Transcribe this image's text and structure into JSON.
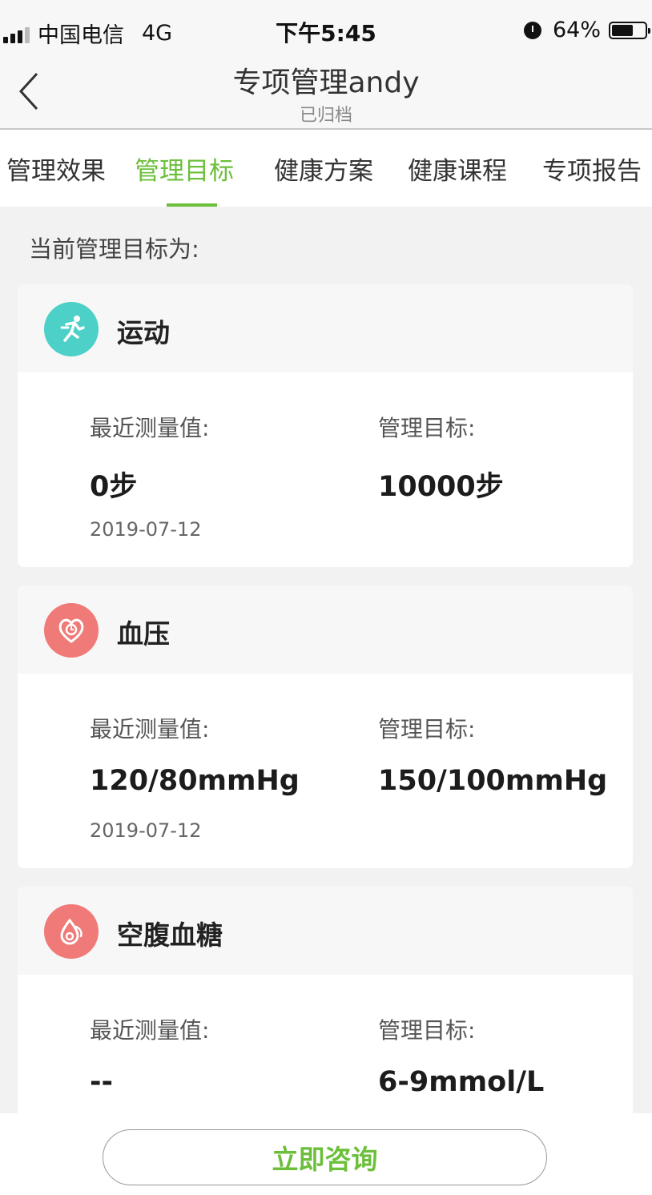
{
  "status_bar": {
    "carrier": "中国电信",
    "network": "4G",
    "time": "下午5:45",
    "battery": "64%",
    "battery_level": 0.64
  },
  "header": {
    "title": "专项管理andy",
    "subtitle": "已归档"
  },
  "tabs": [
    {
      "label": "管理效果"
    },
    {
      "label": "管理目标"
    },
    {
      "label": "健康方案"
    },
    {
      "label": "健康课程"
    },
    {
      "label": "专项报告"
    }
  ],
  "active_tab": "管理目标",
  "section_label": "当前管理目标为:",
  "cards": [
    {
      "title": "运动",
      "icon": "running-icon",
      "icon_color": "#4dd0c8",
      "recent_label": "最近测量值:",
      "recent_value": "0步",
      "recent_date": "2019-07-12",
      "target_label": "管理目标:",
      "target_value": "10000步"
    },
    {
      "title": "血压",
      "icon": "heart-pressure-icon",
      "icon_color": "#f07a78",
      "recent_label": "最近测量值:",
      "recent_value": "120/80mmHg",
      "recent_date": "2019-07-12",
      "target_label": "管理目标:",
      "target_value": "150/100mmHg"
    },
    {
      "title": "空腹血糖",
      "icon": "blood-drop-icon",
      "icon_color": "#f07a78",
      "recent_label": "最近测量值:",
      "recent_value": "--",
      "target_label": "管理目标:",
      "target_value": "6-9mmol/L"
    }
  ],
  "consult_button": "立即咨询",
  "colors": {
    "accent": "#6cbf3a",
    "background": "#f2f2f2"
  }
}
